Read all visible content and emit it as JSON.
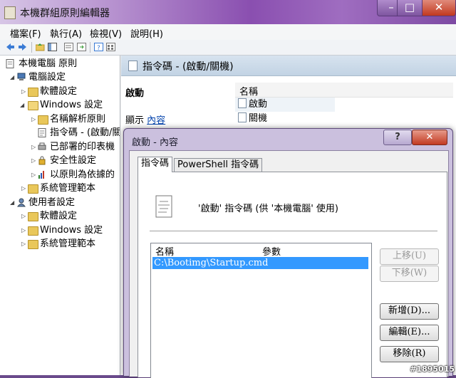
{
  "window": {
    "title": "本機群組原則編輯器",
    "min": "–",
    "max": "□",
    "close": "✕"
  },
  "menu": [
    "檔案(F)",
    "執行(A)",
    "檢視(V)",
    "說明(H)"
  ],
  "tree": {
    "root": "本機電腦 原則",
    "computer": "電腦設定",
    "software": "軟體設定",
    "windows_settings": "Windows 設定",
    "name_resolution": "名稱解析原則",
    "scripts": "指令碼 - (啟動/關",
    "printers": "已部署的印表機",
    "security": "安全性設定",
    "policy_qos": "以原則為依據的",
    "admin_templates": "系統管理範本",
    "user": "使用者設定",
    "user_software": "軟體設定",
    "user_windows": "Windows 設定",
    "user_admin": "系統管理範本"
  },
  "right_pane": {
    "header": "指令碼 - (啟動/關機)",
    "section_title": "啟動",
    "show_label": "顯示",
    "show_link": "內容",
    "column": "名稱",
    "items": [
      "啟動",
      "關機"
    ]
  },
  "dialog": {
    "title": "啟動 - 內容",
    "help": "?",
    "close": "✕",
    "tabs": [
      "指令碼",
      "PowerShell 指令碼"
    ],
    "description": "'啟動' 指令碼 (供 '本機電腦' 使用)",
    "list_columns": [
      "名稱",
      "參數"
    ],
    "list_rows": [
      "C:\\Bootimg\\Startup.cmd"
    ],
    "buttons": {
      "up": "上移(U)",
      "down": "下移(W)",
      "add": "新增(D)...",
      "edit": "編輯(E)...",
      "remove": "移除(R)"
    }
  },
  "watermark": "#1895015"
}
